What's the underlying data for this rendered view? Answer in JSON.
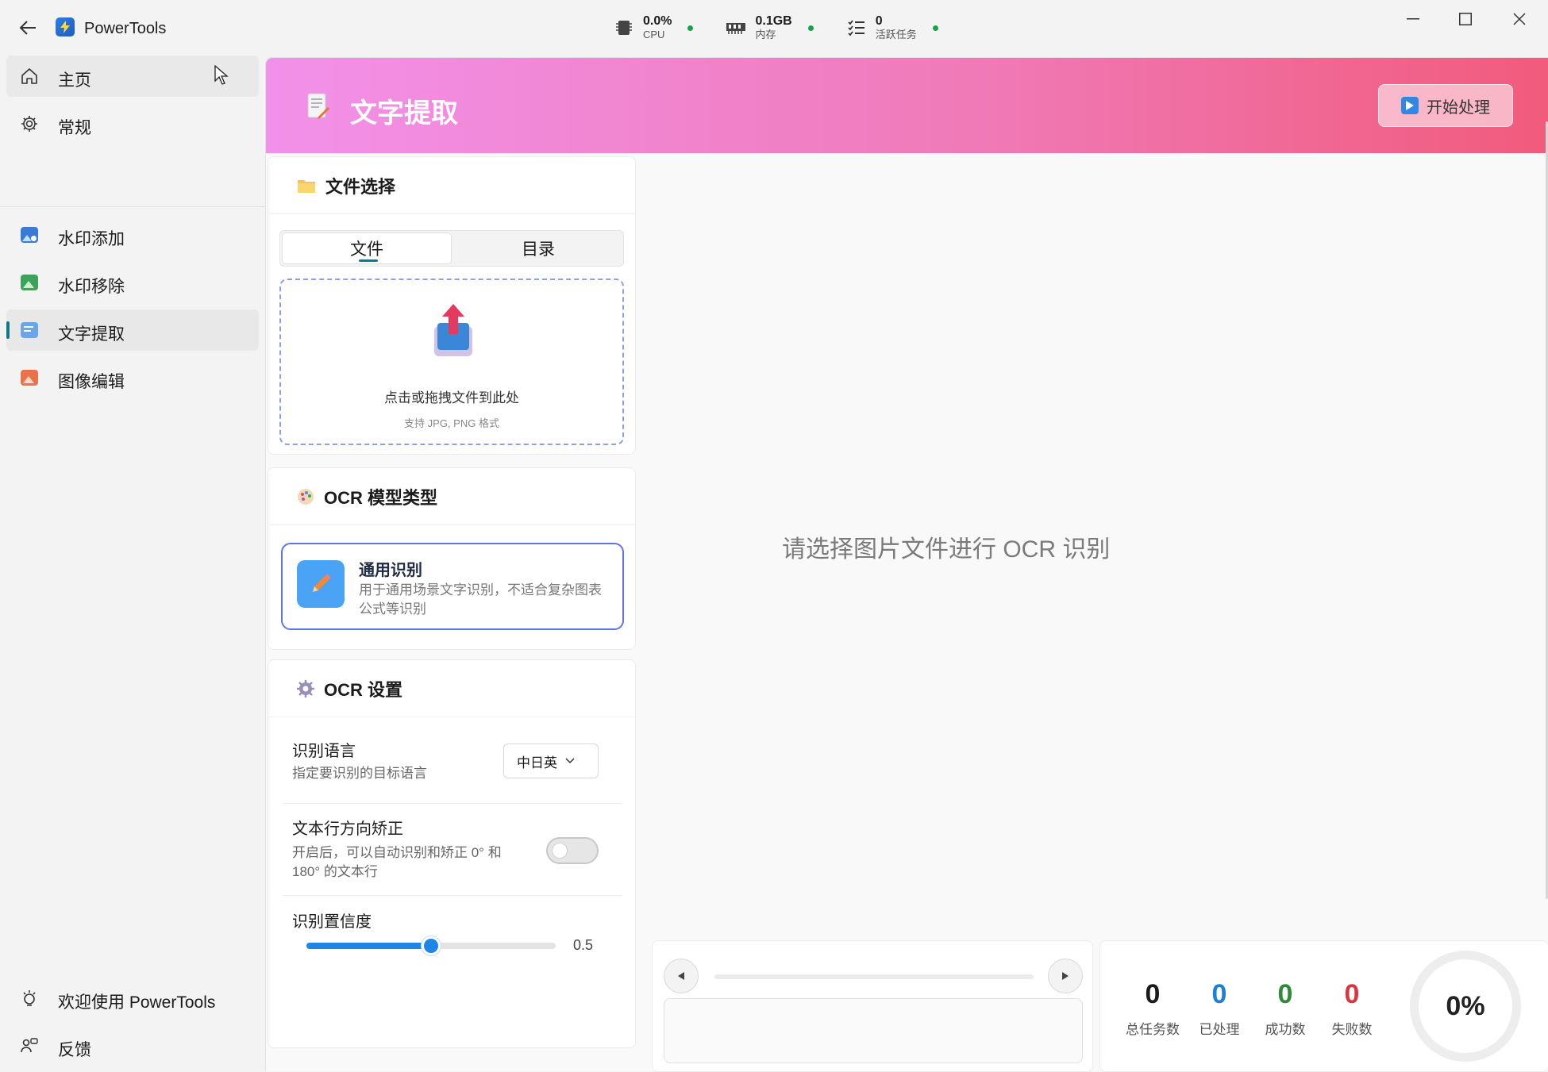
{
  "app": {
    "title": "PowerTools"
  },
  "status": {
    "cpu": {
      "value": "0.0%",
      "label": "CPU"
    },
    "memory": {
      "value": "0.1GB",
      "label": "内存"
    },
    "tasks": {
      "value": "0",
      "label": "活跃任务"
    },
    "indicator_color": "#17a34a"
  },
  "sidebar": {
    "top": [
      {
        "label": "主页",
        "icon": "home-icon"
      },
      {
        "label": "常规",
        "icon": "gear-icon"
      }
    ],
    "tools": [
      {
        "label": "水印添加",
        "icon": "watermark-add-icon"
      },
      {
        "label": "水印移除",
        "icon": "watermark-remove-icon"
      },
      {
        "label": "文字提取",
        "icon": "text-extract-icon",
        "active": true
      },
      {
        "label": "图像编辑",
        "icon": "image-edit-icon"
      }
    ],
    "bottom": [
      {
        "label": "欢迎使用 PowerTools",
        "icon": "welcome-icon"
      },
      {
        "label": "反馈",
        "icon": "feedback-icon"
      }
    ]
  },
  "banner": {
    "title": "文字提取",
    "start_button": "开始处理",
    "gradient": [
      "#f291ea",
      "#f15b7c"
    ]
  },
  "file_select": {
    "title": "文件选择",
    "tabs": [
      "文件",
      "目录"
    ],
    "selected_tab": "文件",
    "drop_main": "点击或拖拽文件到此处",
    "drop_sub": "支持 JPG, PNG 格式"
  },
  "model": {
    "title": "OCR 模型类型",
    "option_title": "通用识别",
    "option_desc": "用于通用场景文字识别，不适合复杂图表公式等识别"
  },
  "settings": {
    "title": "OCR 设置",
    "language": {
      "title": "识别语言",
      "desc": "指定要识别的目标语言",
      "value": "中日英"
    },
    "orientation": {
      "title": "文本行方向矫正",
      "desc": "开启后，可以自动识别和矫正 0° 和 180° 的文本行",
      "enabled": false
    },
    "confidence": {
      "title": "识别置信度",
      "value": "0.5",
      "fraction": 0.5
    }
  },
  "preview": {
    "placeholder": "请选择图片文件进行 OCR 识别"
  },
  "counters": [
    {
      "value": "0",
      "label": "总任务数",
      "color": "#1b1b1b"
    },
    {
      "value": "0",
      "label": "已处理",
      "color": "#1e7fd6"
    },
    {
      "value": "0",
      "label": "成功数",
      "color": "#2e8b3a"
    },
    {
      "value": "0",
      "label": "失败数",
      "color": "#d9363e"
    }
  ],
  "progress": {
    "percent_text": "0%",
    "percent": 0
  },
  "accent": "#0f7b8a"
}
